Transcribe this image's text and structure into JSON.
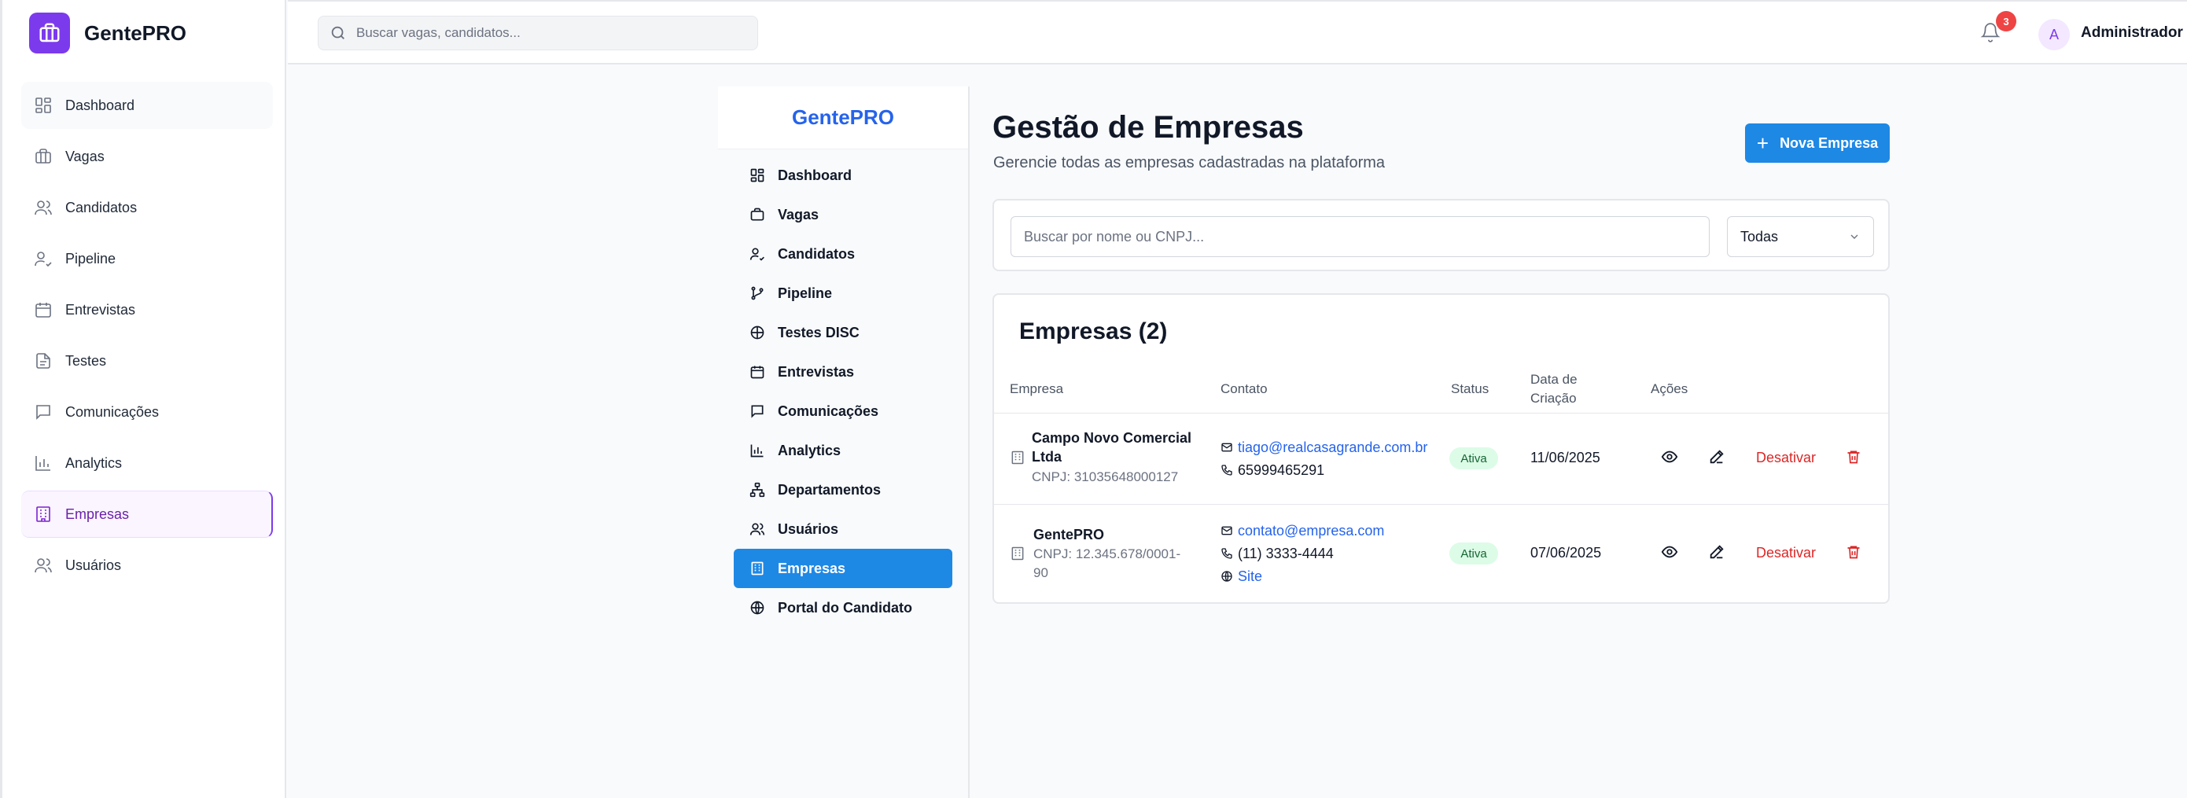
{
  "app": {
    "name": "GentePRO"
  },
  "sidebar": {
    "items": [
      {
        "label": "Dashboard",
        "icon": "dashboard-icon"
      },
      {
        "label": "Vagas",
        "icon": "briefcase-icon"
      },
      {
        "label": "Candidatos",
        "icon": "users-icon"
      },
      {
        "label": "Pipeline",
        "icon": "user-check-icon"
      },
      {
        "label": "Entrevistas",
        "icon": "calendar-icon"
      },
      {
        "label": "Testes",
        "icon": "document-icon"
      },
      {
        "label": "Comunicações",
        "icon": "message-icon"
      },
      {
        "label": "Analytics",
        "icon": "bar-chart-icon"
      },
      {
        "label": "Empresas",
        "icon": "building-icon",
        "active": true
      },
      {
        "label": "Usuários",
        "icon": "users-icon"
      }
    ]
  },
  "topbar": {
    "search_placeholder": "Buscar vagas, candidatos...",
    "notification_count": "3",
    "avatar_initial": "A",
    "user_name": "Administrador M"
  },
  "inner_sidebar": {
    "title": "GentePRO",
    "items": [
      {
        "label": "Dashboard"
      },
      {
        "label": "Vagas"
      },
      {
        "label": "Candidatos"
      },
      {
        "label": "Pipeline"
      },
      {
        "label": "Testes DISC"
      },
      {
        "label": "Entrevistas"
      },
      {
        "label": "Comunicações"
      },
      {
        "label": "Analytics"
      },
      {
        "label": "Departamentos"
      },
      {
        "label": "Usuários"
      },
      {
        "label": "Empresas",
        "active": true
      },
      {
        "label": "Portal do Candidato"
      }
    ]
  },
  "main": {
    "title": "Gestão de Empresas",
    "subtitle": "Gerencie todas as empresas cadastradas na plataforma",
    "new_button": "Nova Empresa",
    "filter": {
      "search_placeholder": "Buscar por nome ou CNPJ...",
      "status_selected": "Todas"
    },
    "table": {
      "title": "Empresas (2)",
      "columns": {
        "empresa": "Empresa",
        "contato": "Contato",
        "status": "Status",
        "data_line1": "Data de",
        "data_line2": "Criação",
        "acoes": "Ações"
      },
      "rows": [
        {
          "name_line1": "Campo Novo Comercial",
          "name_line2": "Ltda",
          "cnpj_line1": "CNPJ: 31035648000127",
          "cnpj_line2": "",
          "email": "tiago@realcasagrande.com.br",
          "phone": "65999465291",
          "site": "",
          "status": "Ativa",
          "created": "11/06/2025",
          "deactivate": "Desativar"
        },
        {
          "name_line1": "GentePRO",
          "name_line2": "",
          "cnpj_line1": "CNPJ: 12.345.678/0001-",
          "cnpj_line2": "90",
          "email": "contato@empresa.com",
          "phone": "(11) 3333-4444",
          "site": "Site",
          "status": "Ativa",
          "created": "07/06/2025",
          "deactivate": "Desativar"
        }
      ]
    }
  },
  "colors": {
    "brand_purple": "#7c3aed",
    "primary_blue": "#1e88e5",
    "status_green_bg": "#dcfce7",
    "danger_red": "#dc2626",
    "badge_red": "#ef4444"
  }
}
